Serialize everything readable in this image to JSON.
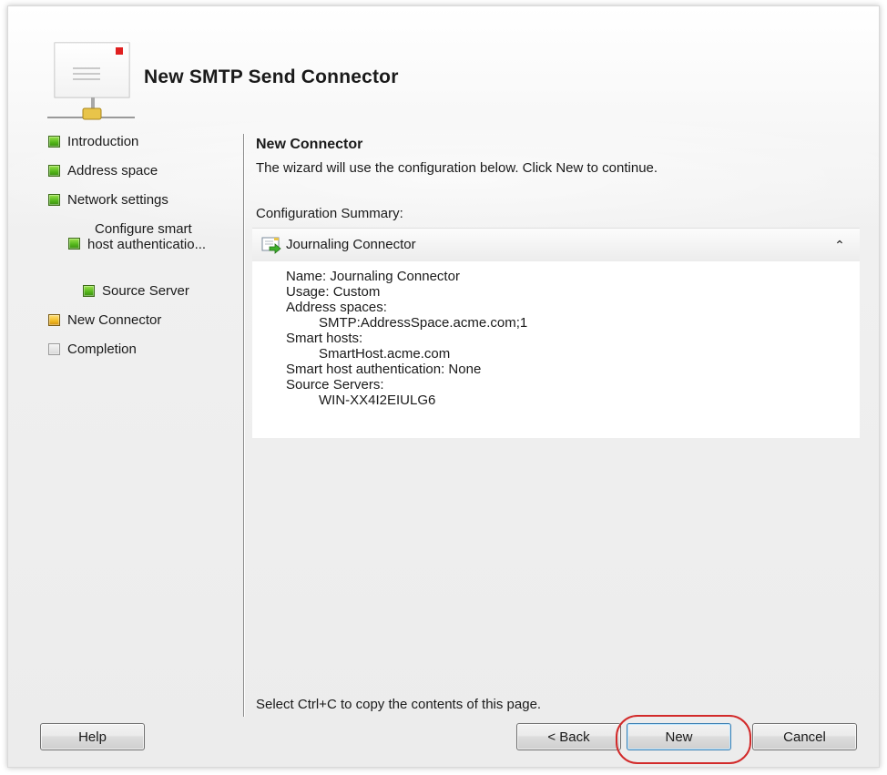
{
  "wizard": {
    "title": "New SMTP Send Connector"
  },
  "nav": {
    "items": [
      {
        "label": "Introduction",
        "status": "complete"
      },
      {
        "label": "Address space",
        "status": "complete"
      },
      {
        "label": "Network settings",
        "status": "complete"
      },
      {
        "label_line1": "Configure smart",
        "label_line2": "host authenticatio...",
        "status": "complete"
      },
      {
        "label": "Source Server",
        "status": "complete"
      },
      {
        "label": "New Connector",
        "status": "current"
      },
      {
        "label": "Completion",
        "status": "pending"
      }
    ]
  },
  "content": {
    "title": "New Connector",
    "description": "The wizard will use the configuration below.  Click New to continue.",
    "summary_label": "Configuration Summary:",
    "panel": {
      "icon": "send-connector-icon",
      "title": "Journaling Connector",
      "lines": [
        "Name: Journaling Connector",
        "Usage: Custom",
        "Address spaces:",
        "SMTP:AddressSpace.acme.com;1",
        "Smart hosts:",
        "SmartHost.acme.com",
        "Smart host authentication: None",
        "Source Servers:",
        "WIN-XX4I2EIULG6"
      ]
    },
    "copy_hint": "Select Ctrl+C to copy the contents of this page."
  },
  "buttons": {
    "help": "Help",
    "back": "< Back",
    "new": "New",
    "cancel": "Cancel"
  },
  "colors": {
    "complete": "#52b41a",
    "current": "#f0b820",
    "pending": "#d8d8d8",
    "highlight": "#d22a2a"
  }
}
